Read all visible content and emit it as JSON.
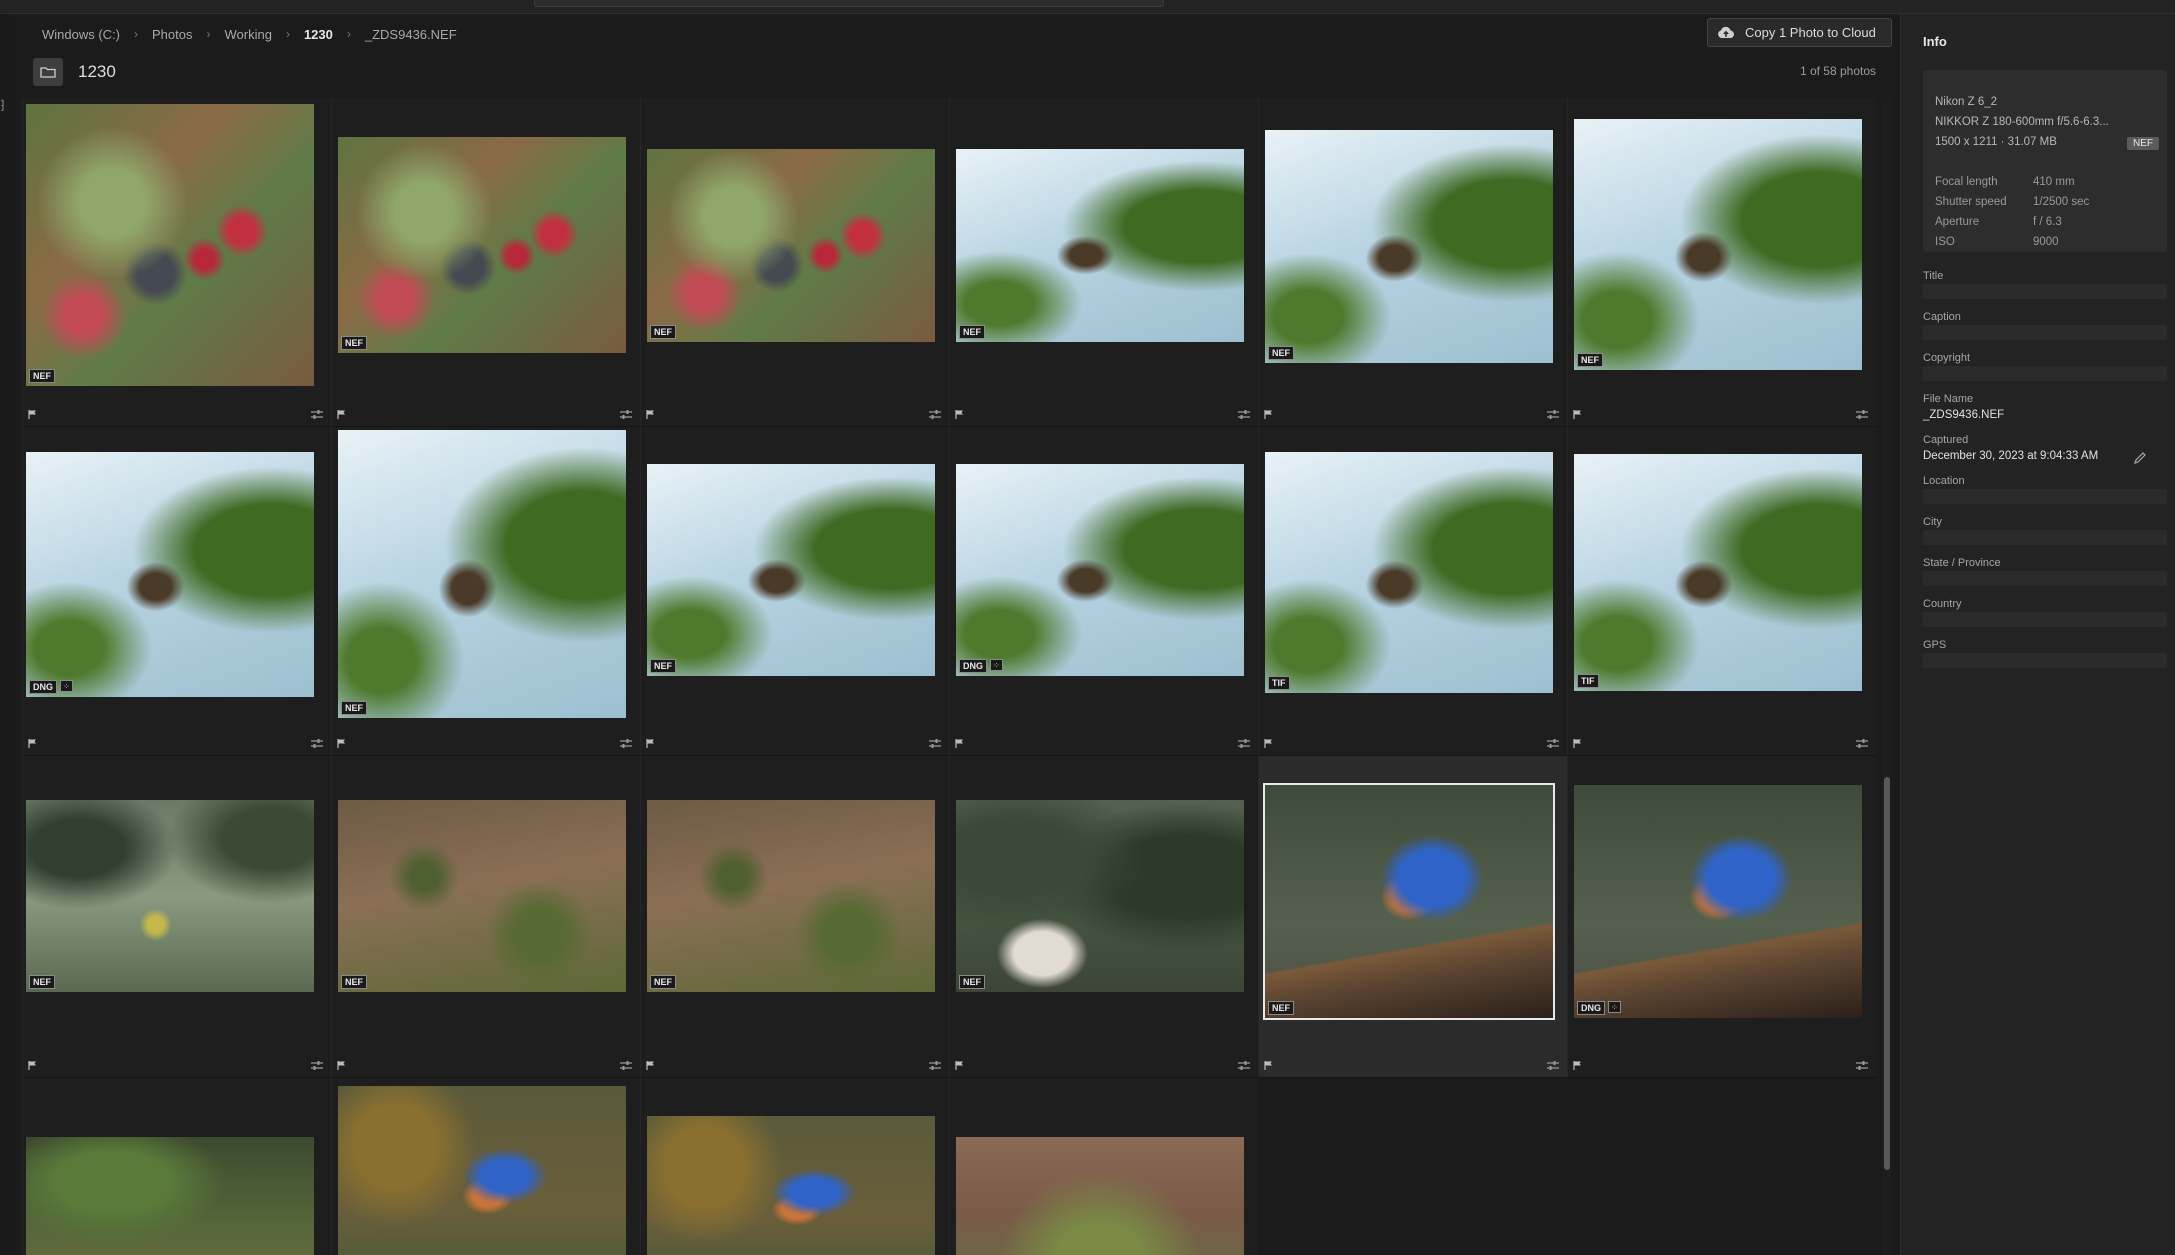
{
  "breadcrumb": [
    "Windows (C:)",
    "Photos",
    "Working",
    "1230",
    "_ZDS9436.NEF"
  ],
  "cloud_button": {
    "label": "Copy 1 Photo to Cloud",
    "icon": "cloud-upload-icon"
  },
  "folder": {
    "title": "1230",
    "icon": "folder-icon",
    "count": "1 of 58 photos"
  },
  "rows": [
    [
      {
        "format": "NEF",
        "stack": false,
        "img": "berry"
      },
      {
        "format": "NEF",
        "stack": false,
        "img": "berry"
      },
      {
        "format": "NEF",
        "stack": false,
        "img": "berry"
      },
      {
        "format": "NEF",
        "stack": false,
        "img": "sky"
      },
      {
        "format": "NEF",
        "stack": false,
        "img": "sky"
      },
      {
        "format": "NEF",
        "stack": false,
        "img": "sky"
      }
    ],
    [
      {
        "format": "DNG",
        "stack": true,
        "img": "sky"
      },
      {
        "format": "NEF",
        "stack": false,
        "img": "sky"
      },
      {
        "format": "NEF",
        "stack": false,
        "img": "sky"
      },
      {
        "format": "DNG",
        "stack": true,
        "img": "sky"
      },
      {
        "format": "TIF",
        "stack": false,
        "img": "sky"
      },
      {
        "format": "TIF",
        "stack": false,
        "img": "sky"
      }
    ],
    [
      {
        "format": "NEF",
        "stack": false,
        "img": "branch"
      },
      {
        "format": "NEF",
        "stack": false,
        "img": "ground"
      },
      {
        "format": "NEF",
        "stack": false,
        "img": "ground"
      },
      {
        "format": "NEF",
        "stack": false,
        "img": "birdhouse"
      },
      {
        "format": "NEF",
        "stack": false,
        "img": "bluebird",
        "selected": true
      },
      {
        "format": "DNG",
        "stack": true,
        "img": "bluebird"
      }
    ],
    [
      {
        "img": "green"
      },
      {
        "img": "blueperch"
      },
      {
        "img": "blueperch"
      },
      {
        "img": "field"
      }
    ]
  ],
  "info_panel": {
    "title": "Info",
    "camera": "Nikon Z 6_2",
    "lens": "NIKKOR Z 180-600mm f/5.6-6.3...",
    "dimensions": "1500 x 1211  ·  31.07 MB",
    "format_chip": "NEF",
    "exif": [
      {
        "label": "Focal length",
        "value": "410 mm"
      },
      {
        "label": "Shutter speed",
        "value": "1/2500 sec"
      },
      {
        "label": "Aperture",
        "value": "f / 6.3"
      },
      {
        "label": "ISO",
        "value": "9000"
      }
    ],
    "fields": {
      "title": "Title",
      "caption": "Caption",
      "copyright": "Copyright",
      "file_name_label": "File Name",
      "file_name": "_ZDS9436.NEF",
      "captured_label": "Captured",
      "captured": "December 30, 2023 at 9:04:33 AM",
      "location": "Location",
      "city": "City",
      "state": "State / Province",
      "country": "Country",
      "gps": "GPS"
    }
  },
  "colors": {
    "background": "#1b1b1b",
    "panel": "#232323",
    "selection": "#e8e8e8"
  }
}
